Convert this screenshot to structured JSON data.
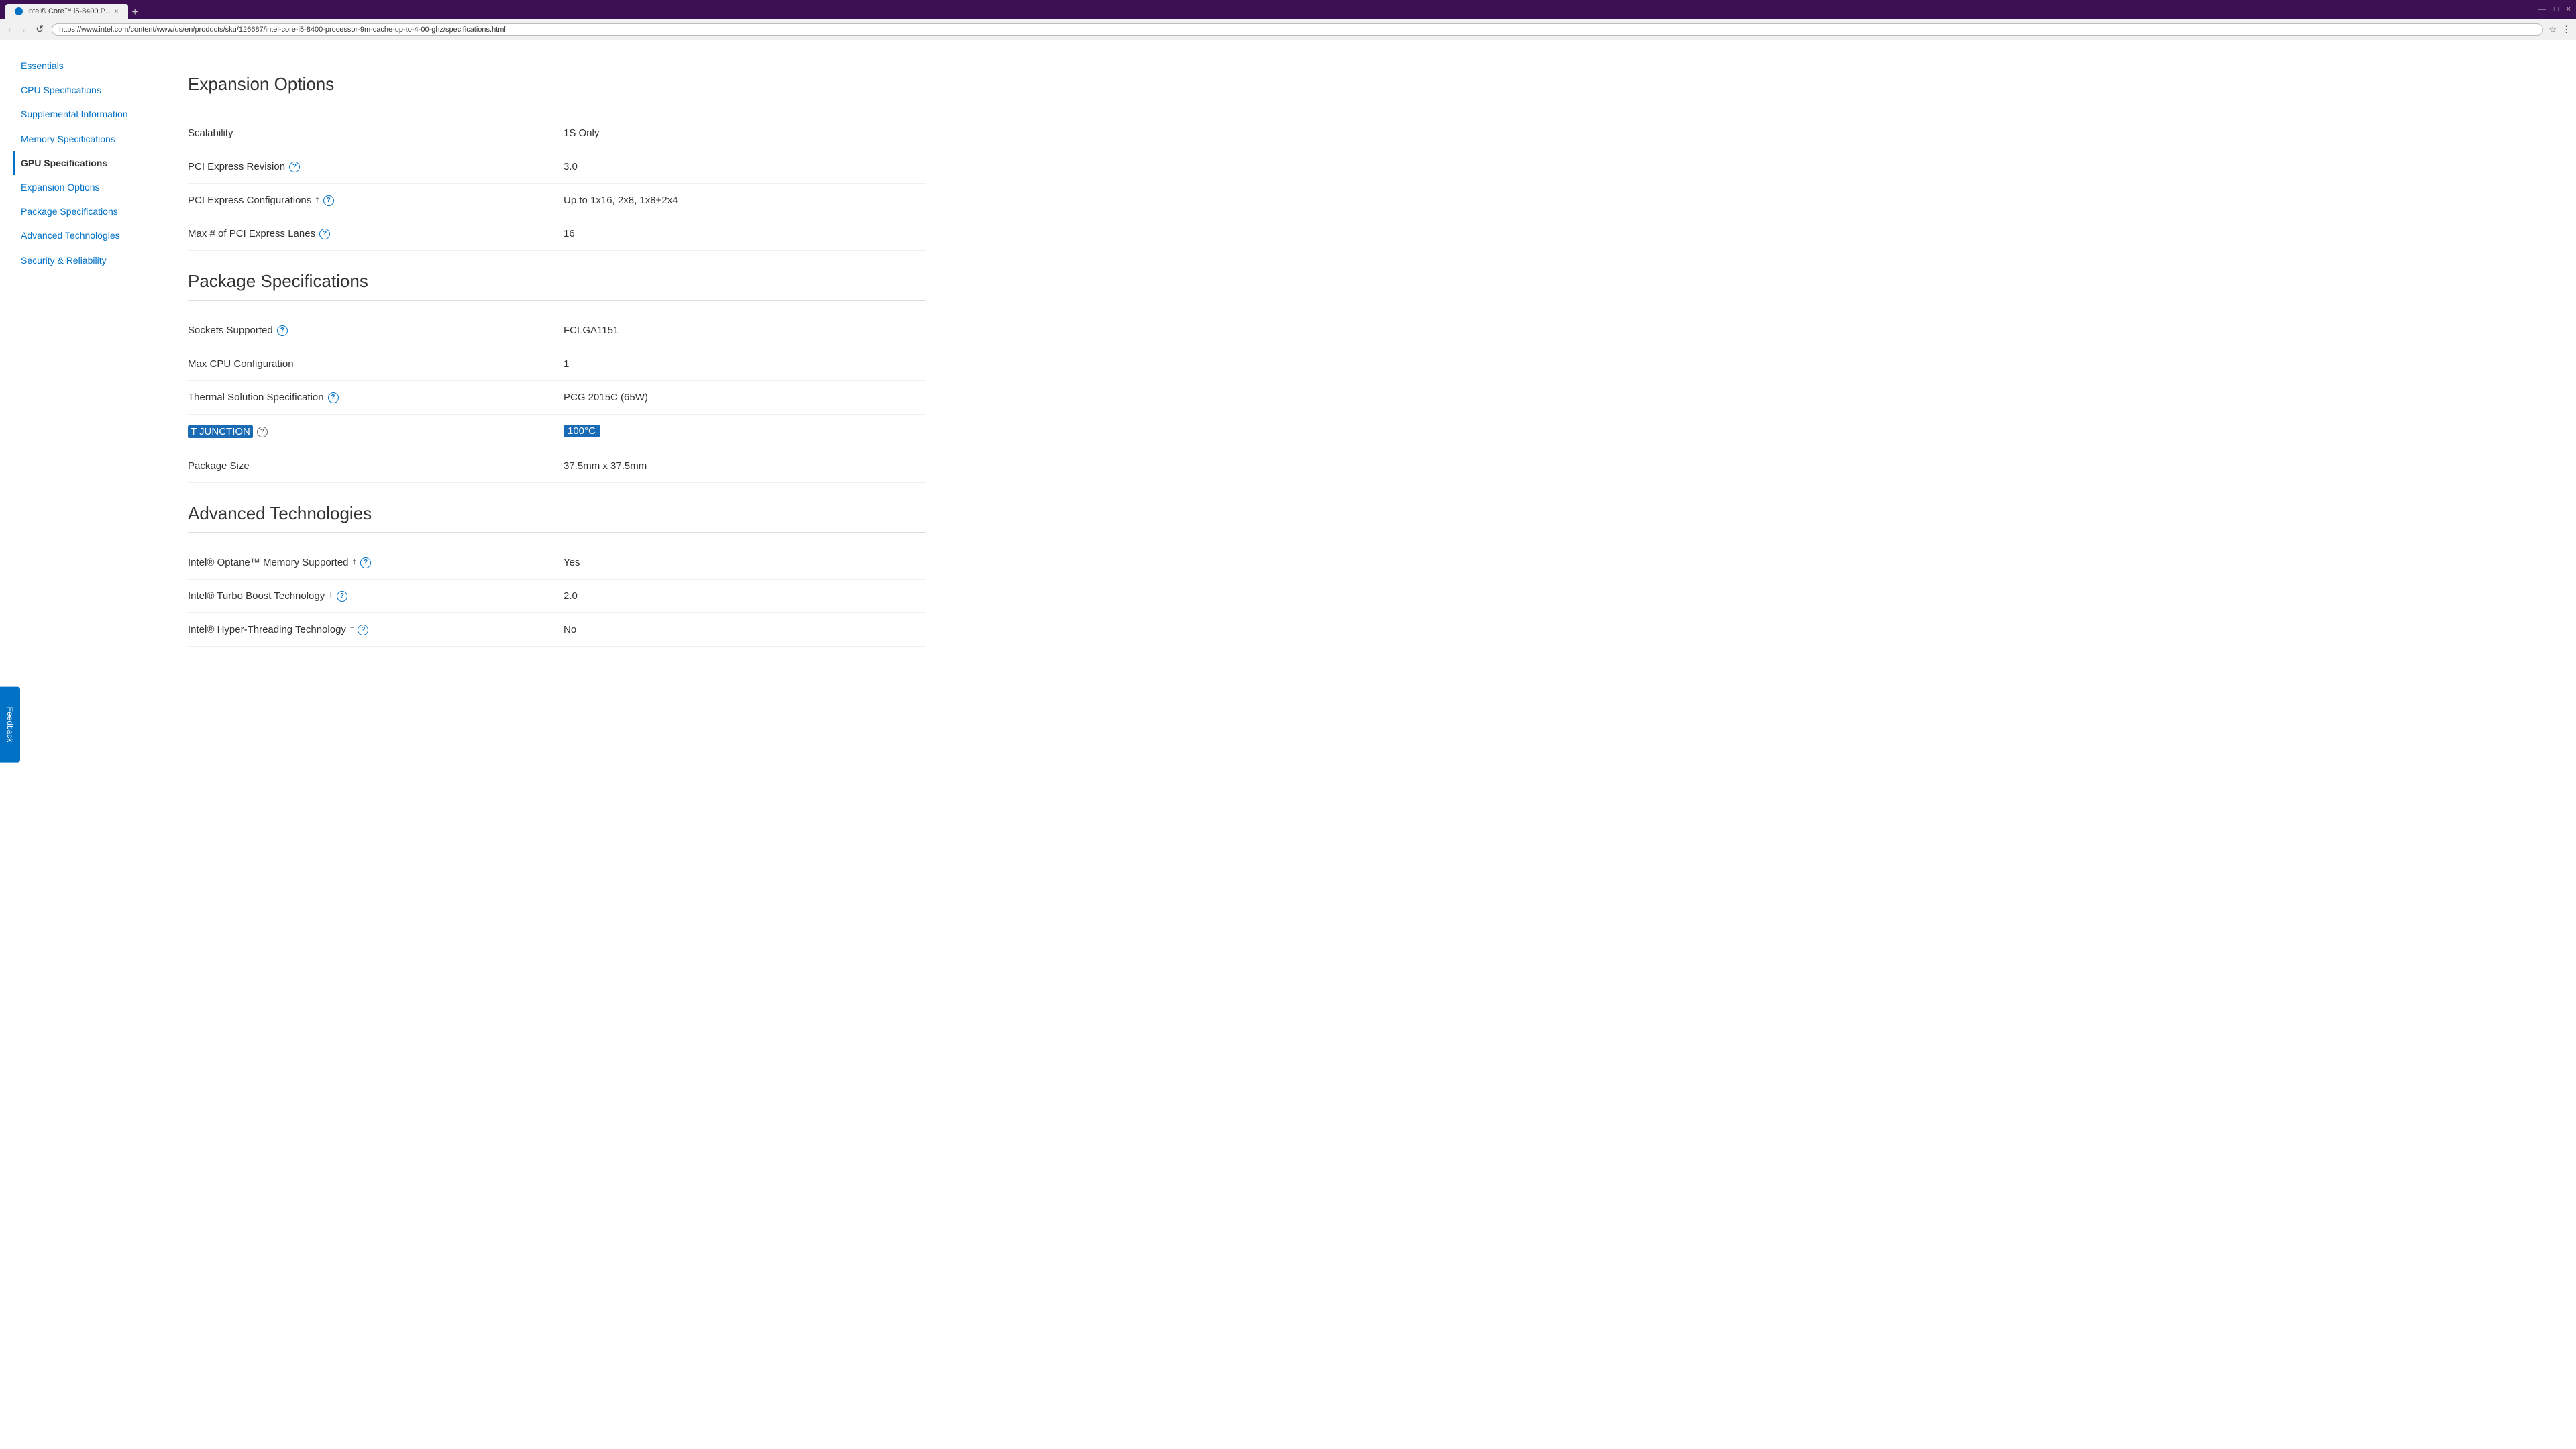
{
  "browser": {
    "tab_title": "Intel® Core™ i5-8400 P...",
    "favicon": "intel",
    "url": "https://www.intel.com/content/www/us/en/products/sku/126687/intel-core-i5-8400-processor-9m-cache-up-to-4-00-ghz/specifications.html",
    "new_tab_label": "+",
    "close_label": "×"
  },
  "nav_buttons": {
    "back": "‹",
    "forward": "›",
    "reload": "↺"
  },
  "feedback": {
    "label": "Feedback"
  },
  "sidebar": {
    "items": [
      {
        "id": "essentials",
        "label": "Essentials",
        "active": false
      },
      {
        "id": "cpu-specifications",
        "label": "CPU Specifications",
        "active": false
      },
      {
        "id": "supplemental-information",
        "label": "Supplemental Information",
        "active": false
      },
      {
        "id": "memory-specifications",
        "label": "Memory Specifications",
        "active": false
      },
      {
        "id": "gpu-specifications",
        "label": "GPU Specifications",
        "active": true
      },
      {
        "id": "expansion-options",
        "label": "Expansion Options",
        "active": false
      },
      {
        "id": "package-specifications",
        "label": "Package Specifications",
        "active": false
      },
      {
        "id": "advanced-technologies",
        "label": "Advanced Technologies",
        "active": false
      },
      {
        "id": "security-reliability",
        "label": "Security & Reliability",
        "active": false
      }
    ]
  },
  "sections": {
    "expansion_options": {
      "title": "Expansion Options",
      "rows": [
        {
          "label": "Scalability",
          "has_info": false,
          "has_dagger": false,
          "value": "1S Only"
        },
        {
          "label": "PCI Express Revision",
          "has_info": true,
          "has_dagger": false,
          "value": "3.0"
        },
        {
          "label": "PCI Express Configurations",
          "has_info": true,
          "has_dagger": true,
          "value": "Up to 1x16, 2x8, 1x8+2x4"
        },
        {
          "label": "Max # of PCI Express Lanes",
          "has_info": true,
          "has_dagger": false,
          "value": "16"
        }
      ]
    },
    "package_specifications": {
      "title": "Package Specifications",
      "rows": [
        {
          "label": "Sockets Supported",
          "has_info": true,
          "has_dagger": false,
          "value": "FCLGA1151"
        },
        {
          "label": "Max CPU Configuration",
          "has_info": false,
          "has_dagger": false,
          "value": "1"
        },
        {
          "label": "Thermal Solution Specification",
          "has_info": true,
          "has_dagger": false,
          "value": "PCG 2015C (65W)"
        },
        {
          "label": "T JUNCTION",
          "has_info": true,
          "has_dagger": false,
          "value": "100°C",
          "label_highlighted": true,
          "value_highlighted": true
        },
        {
          "label": "Package Size",
          "has_info": false,
          "has_dagger": false,
          "value": "37.5mm x 37.5mm"
        }
      ]
    },
    "advanced_technologies": {
      "title": "Advanced Technologies",
      "rows": [
        {
          "label": "Intel® Optane™ Memory Supported",
          "has_info": true,
          "has_dagger": true,
          "value": "Yes"
        },
        {
          "label": "Intel® Turbo Boost Technology",
          "has_info": true,
          "has_dagger": true,
          "value": "2.0"
        },
        {
          "label": "Intel® Hyper-Threading Technology",
          "has_info": true,
          "has_dagger": true,
          "value": "No"
        }
      ]
    }
  },
  "icons": {
    "info": "?",
    "dagger": "†"
  }
}
